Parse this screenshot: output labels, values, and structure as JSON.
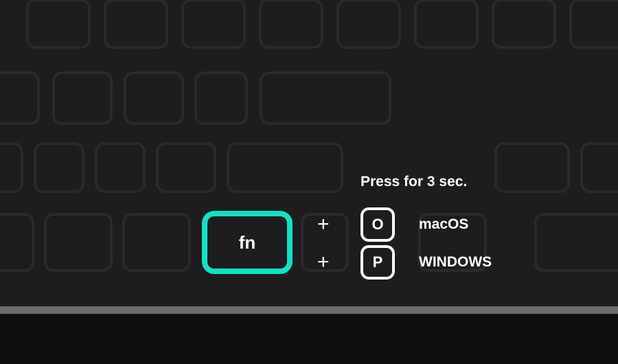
{
  "fn_key_label": "fn",
  "plus_symbol_1": "+",
  "plus_symbol_2": "+",
  "instruction": "Press for 3 sec.",
  "combo_key_1": "O",
  "combo_key_2": "P",
  "os_label_1": "macOS",
  "os_label_2": "WINDOWS",
  "highlight_color": "#0fe3c2"
}
